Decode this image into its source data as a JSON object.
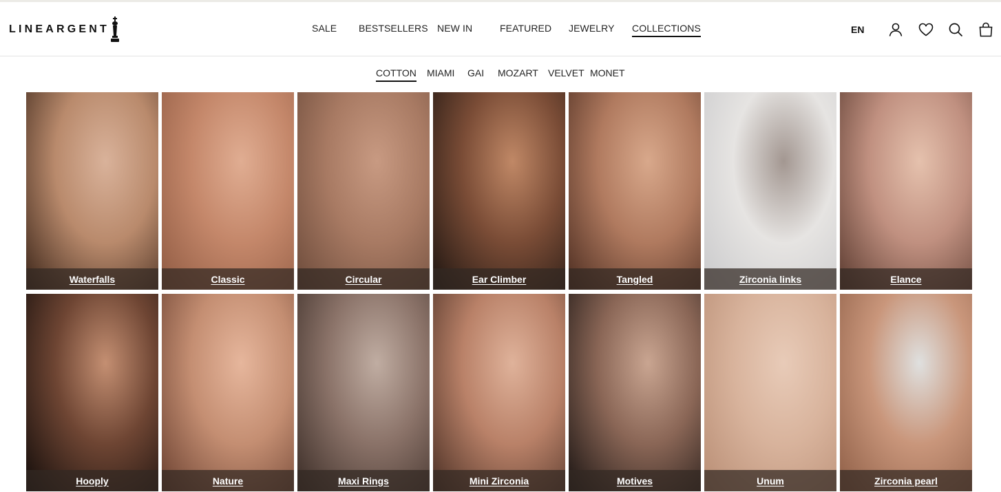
{
  "brand": {
    "name": "LINEARGENT"
  },
  "header": {
    "nav": [
      {
        "label": "SALE",
        "active": false
      },
      {
        "label": "BESTSELLERS",
        "active": false
      },
      {
        "label": "NEW IN",
        "active": false
      },
      {
        "label": "FEATURED",
        "active": false
      },
      {
        "label": "JEWELRY",
        "active": false
      },
      {
        "label": "COLLECTIONS",
        "active": true
      }
    ],
    "language": "EN",
    "icons": [
      "account-icon",
      "wishlist-heart-icon",
      "search-icon",
      "shopping-bag-icon"
    ]
  },
  "subnav": [
    {
      "label": "COTTON",
      "active": true
    },
    {
      "label": "MIAMI",
      "active": false
    },
    {
      "label": "GAI",
      "active": false
    },
    {
      "label": "MOZART",
      "active": false
    },
    {
      "label": "VELVET",
      "active": false
    },
    {
      "label": "MONET",
      "active": false
    }
  ],
  "collections": [
    {
      "name": "Waterfalls",
      "colors": [
        "#3a2418",
        "#b98a6c",
        "#d9b29a"
      ]
    },
    {
      "name": "Classic",
      "colors": [
        "#8f5a42",
        "#c4876a",
        "#e0ad92"
      ]
    },
    {
      "name": "Circular",
      "colors": [
        "#6b4a3a",
        "#a87a63",
        "#c89a82"
      ]
    },
    {
      "name": "Ear Climber",
      "colors": [
        "#1c1410",
        "#7a4c36",
        "#c08866"
      ]
    },
    {
      "name": "Tangled",
      "colors": [
        "#4b2c20",
        "#b07a5f",
        "#d8a88b"
      ]
    },
    {
      "name": "Zirconia links",
      "colors": [
        "#c9c9cb",
        "#e6e4e2",
        "#a39791"
      ]
    },
    {
      "name": "Elance",
      "colors": [
        "#5a3a2f",
        "#c09080",
        "#e5c1ad"
      ]
    },
    {
      "name": "Hooply",
      "colors": [
        "#120c0a",
        "#6e4533",
        "#c48f72"
      ]
    },
    {
      "name": "Nature",
      "colors": [
        "#6a4030",
        "#c48e72",
        "#e6b69c"
      ]
    },
    {
      "name": "Maxi Rings",
      "colors": [
        "#3a2c26",
        "#8a7268",
        "#c0ada2"
      ]
    },
    {
      "name": "Mini Zirconia",
      "colors": [
        "#4a2f24",
        "#b98168",
        "#dfb29a"
      ]
    },
    {
      "name": "Motives",
      "colors": [
        "#1a1412",
        "#8a6656",
        "#c9a591"
      ]
    },
    {
      "name": "Unum",
      "colors": [
        "#b88d74",
        "#d8b39c",
        "#e8cbb8"
      ]
    },
    {
      "name": "Zirconia pearl",
      "colors": [
        "#8e5e46",
        "#c9967b",
        "#dfe0df"
      ]
    }
  ]
}
